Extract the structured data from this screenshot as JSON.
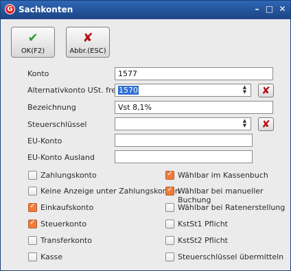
{
  "titlebar": {
    "title": "Sachkonten",
    "app_icon": "G",
    "minimize": "–",
    "maximize": "□",
    "close": "✕"
  },
  "toolbar": {
    "ok_icon": "✔",
    "ok_label": "OK(F2)",
    "cancel_icon": "✘",
    "cancel_label": "Abbr.(ESC)"
  },
  "form": {
    "konto_label": "Konto",
    "konto_value": "1577",
    "alt_label": "Alternativkonto  USt. frei",
    "alt_value": "1570",
    "bez_label": "Bezeichnung",
    "bez_value": "Vst 8,1%",
    "steuer_label": "Steuerschlüssel",
    "steuer_value": "",
    "eu_label": "EU-Konto",
    "eu_value": "",
    "euausland_label": "EU-Konto Ausland",
    "euausland_value": "",
    "delete_icon": "✘"
  },
  "checks": {
    "zahlungskonto": {
      "label": "Zahlungskonto",
      "checked": false
    },
    "keine_anzeige": {
      "label": "Keine Anzeige unter Zahlungskonten",
      "checked": false
    },
    "einkaufskonto": {
      "label": "Einkaufskonto",
      "checked": true
    },
    "steuerkonto": {
      "label": "Steuerkonto",
      "checked": true
    },
    "transferkonto": {
      "label": "Transferkonto",
      "checked": false
    },
    "kasse": {
      "label": "Kasse",
      "checked": false
    },
    "kassenbuch": {
      "label": "Wählbar im Kassenbuch",
      "checked": true
    },
    "manuelle_buchung": {
      "label": "Wählbar bei manueller Buchung",
      "checked": true
    },
    "ratenerstellung": {
      "label": "Wählbar bei Ratenerstellung",
      "checked": false
    },
    "kst1": {
      "label": "KstSt1 Pflicht",
      "checked": false
    },
    "kst2": {
      "label": "KstSt2 Pflicht",
      "checked": false
    },
    "uebermitteln": {
      "label": "Steuerschlüssel übermitteln",
      "checked": false
    }
  }
}
